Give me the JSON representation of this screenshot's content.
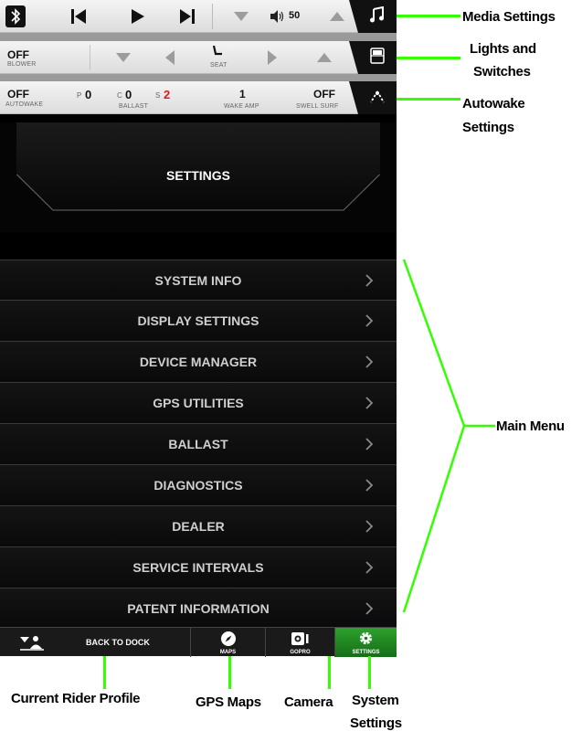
{
  "media_bar": {
    "volume": "50"
  },
  "lights_bar": {
    "blower_value": "OFF",
    "blower_label": "BLOWER",
    "seat_label": "SEAT"
  },
  "wake_bar": {
    "autowake_value": "OFF",
    "autowake_label": "AUTOWAKE",
    "ballast_p_prefix": "P",
    "ballast_p": "0",
    "ballast_c_prefix": "C",
    "ballast_c": "0",
    "ballast_s_prefix": "S",
    "ballast_s": "2",
    "ballast_label": "BALLAST",
    "wake_amp_value": "1",
    "wake_amp_label": "WAKE AMP",
    "swell_value": "OFF",
    "swell_label": "SWELL SURF"
  },
  "header": {
    "title": "SETTINGS"
  },
  "menu": {
    "items": [
      {
        "label": "SYSTEM INFO"
      },
      {
        "label": "DISPLAY SETTINGS"
      },
      {
        "label": "DEVICE MANAGER"
      },
      {
        "label": "GPS UTILITIES"
      },
      {
        "label": "BALLAST"
      },
      {
        "label": "DIAGNOSTICS"
      },
      {
        "label": "DEALER"
      },
      {
        "label": "SERVICE INTERVALS"
      },
      {
        "label": "PATENT INFORMATION"
      }
    ]
  },
  "bottom_nav": {
    "back_to_dock": "BACK TO DOCK",
    "maps": "MAPS",
    "gopro": "GOPRO",
    "settings": "SETTINGS"
  },
  "annotations": {
    "media_settings": "Media Settings",
    "lights_and_switches_1": "Lights and",
    "lights_and_switches_2": "Switches",
    "autowake_settings_1": "Autowake",
    "autowake_settings_2": "Settings",
    "main_menu": "Main Menu",
    "current_rider_profile": "Current Rider Profile",
    "gps_maps": "GPS Maps",
    "camera": "Camera",
    "system_settings_1": "System",
    "system_settings_2": "Settings"
  },
  "colors": {
    "accent_green": "#33ff00",
    "active_nav": "#1f8a1f",
    "ballast_s_red": "#e01818"
  }
}
